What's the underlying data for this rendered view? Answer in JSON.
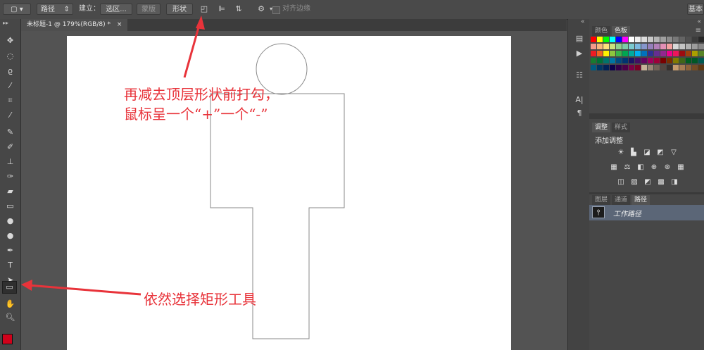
{
  "options_bar": {
    "mode_select": "路径",
    "make_label": "建立：",
    "selection_button": "选区...",
    "mask_button": "蒙版",
    "shape_button": "形状",
    "align_edges_label": "对齐边缘",
    "workspace_button": "基本"
  },
  "document": {
    "tab_title": "未标题-1 @ 179%(RGB/8) *",
    "tab_close": "×"
  },
  "panels": {
    "swatch_tabs": [
      "颜色",
      "色板"
    ],
    "adjust_tabs": [
      "调整",
      "样式"
    ],
    "add_adjustment_label": "添加调整",
    "layer_tabs": [
      "图层",
      "通道",
      "路径"
    ],
    "path_item_label": "工作路径",
    "collapse_glyph": "«",
    "menu_glyph": "≡"
  },
  "annotations": {
    "line1": "再减去顶层形状前打勾，",
    "line2": "鼠标呈一个“+”一个“-”",
    "line3": "依然选择矩形工具"
  },
  "colors": {
    "annotation_red": "#e8333a",
    "foreground_swatch": "#d0021b",
    "path_stroke": "#8a8a8a"
  },
  "swatches": [
    [
      "#ff0000",
      "#ffff00",
      "#00ff00",
      "#00ffff",
      "#0000ff",
      "#ff00ff",
      "#ffffff",
      "#f0f0f0",
      "#dcdcdc",
      "#c8c8c8",
      "#b4b4b4",
      "#a0a0a0",
      "#8c8c8c",
      "#787878",
      "#646464",
      "#505050",
      "#3c3c3c",
      "#282828"
    ],
    [
      "#f39a8a",
      "#f6b67c",
      "#fbe07c",
      "#c9e27d",
      "#8fd18e",
      "#7ccaa7",
      "#7bcacf",
      "#7bb8e0",
      "#8596cc",
      "#957fbb",
      "#b27fb9",
      "#e28fb5",
      "#f5a0a0",
      "#d8d8d8",
      "#c4c4c4",
      "#b0b0b0",
      "#9c9c9c",
      "#888888"
    ],
    [
      "#ee1c24",
      "#f26522",
      "#fff200",
      "#8dc63f",
      "#39b54a",
      "#00a651",
      "#00a99d",
      "#00aeef",
      "#0072bc",
      "#2e3192",
      "#662d91",
      "#92278f",
      "#ec008c",
      "#ed145b",
      "#9e0b0f",
      "#a0410d",
      "#aba000",
      "#598527"
    ],
    [
      "#197b30",
      "#007236",
      "#00746b",
      "#0076a3",
      "#004a80",
      "#003471",
      "#1b1464",
      "#440e62",
      "#630460",
      "#9e005d",
      "#9e0039",
      "#790000",
      "#7b2e00",
      "#827b00",
      "#406618",
      "#005e20",
      "#005826",
      "#005952"
    ],
    [
      "#005b7f",
      "#003663",
      "#002157",
      "#0d004c",
      "#32004b",
      "#4b0049",
      "#7b0046",
      "#7a0026",
      "#c7b299",
      "#998675",
      "#736357",
      "#534741",
      "#37302d",
      "#c69c6d",
      "#a67c52",
      "#8c6239",
      "#754c24",
      "#603913"
    ]
  ]
}
